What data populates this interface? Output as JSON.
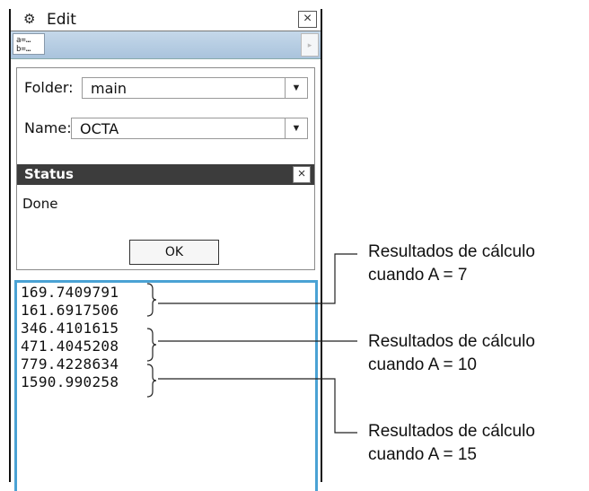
{
  "window": {
    "title": "Edit",
    "gear_icon": "gear-icon",
    "close_symbol": "×"
  },
  "toolbar": {
    "var_button_line1": "a=…",
    "var_button_line2": "b=…",
    "arrow_symbol": "▸"
  },
  "dialog": {
    "folder_label": "Folder:",
    "folder_value": "main",
    "name_label": "Name:",
    "name_value": "OCTA",
    "dropdown_symbol": "▼",
    "status_title": "Status",
    "status_close": "×",
    "status_text": "Done",
    "ok_label": "OK"
  },
  "results": [
    {
      "value": "169.7409791"
    },
    {
      "value": "161.6917506"
    },
    {
      "value": "346.4101615"
    },
    {
      "value": "471.4045208"
    },
    {
      "value": "779.4228634"
    },
    {
      "value": "1590.990258"
    }
  ],
  "callouts": [
    {
      "line1": "Resultados de cálculo",
      "line2": "cuando A = 7"
    },
    {
      "line1": "Resultados de cálculo",
      "line2": "cuando A = 10"
    },
    {
      "line1": "Resultados de cálculo",
      "line2": "cuando A = 15"
    }
  ],
  "colors": {
    "results_border": "#4aa2d4",
    "toolbar_bg": "#b8cfe4",
    "status_bar": "#3c3c3c"
  }
}
